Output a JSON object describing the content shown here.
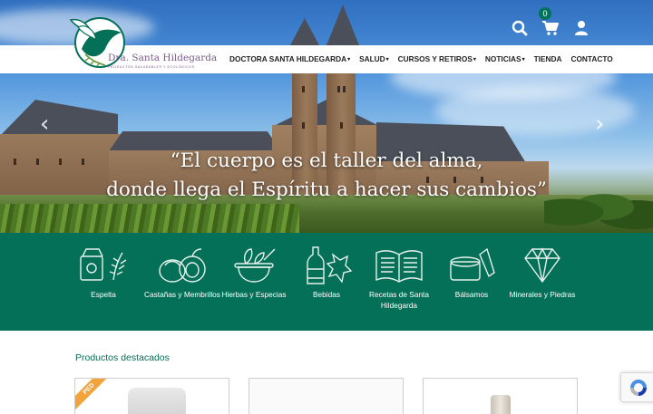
{
  "brand": {
    "name": "Dra. Santa Hildegarda",
    "tagline": "PRODUCTOS SALUDABLES Y ECOLÓGICOS"
  },
  "header": {
    "cart_count": "0",
    "icons": [
      "search-icon",
      "cart-icon",
      "user-icon"
    ]
  },
  "nav": {
    "items": [
      {
        "label": "DOCTORA SANTA HILDEGARDA",
        "dropdown": true
      },
      {
        "label": "SALUD",
        "dropdown": true
      },
      {
        "label": "CURSOS Y RETIROS",
        "dropdown": true
      },
      {
        "label": "NOTICIAS",
        "dropdown": true
      },
      {
        "label": "TIENDA",
        "dropdown": false
      },
      {
        "label": "CONTACTO",
        "dropdown": false
      }
    ],
    "caret": "▾"
  },
  "hero": {
    "quote_line1": "“El cuerpo es el taller del alma,",
    "quote_line2": "donde llega el Espíritu a hacer sus cambios”",
    "prev": "‹",
    "next": "›"
  },
  "categories": [
    {
      "label": "Espelta",
      "icon": "spelt-icon"
    },
    {
      "label": "Castañas y Membrillos",
      "icon": "chestnut-icon"
    },
    {
      "label": "Hierbas y Especias",
      "icon": "herbs-icon"
    },
    {
      "label": "Bebidas",
      "icon": "drinks-icon"
    },
    {
      "label": "Recetas de Santa Hildegarda",
      "icon": "book-icon"
    },
    {
      "label": "Bálsamos",
      "icon": "balm-icon"
    },
    {
      "label": "Minerales y Piedras",
      "icon": "diamond-icon"
    }
  ],
  "products": {
    "title": "Productos destacados",
    "badge": "PED"
  },
  "colors": {
    "brand_green": "#047057",
    "title_green": "#0a6b57",
    "badge_orange": "#f2a33a"
  }
}
